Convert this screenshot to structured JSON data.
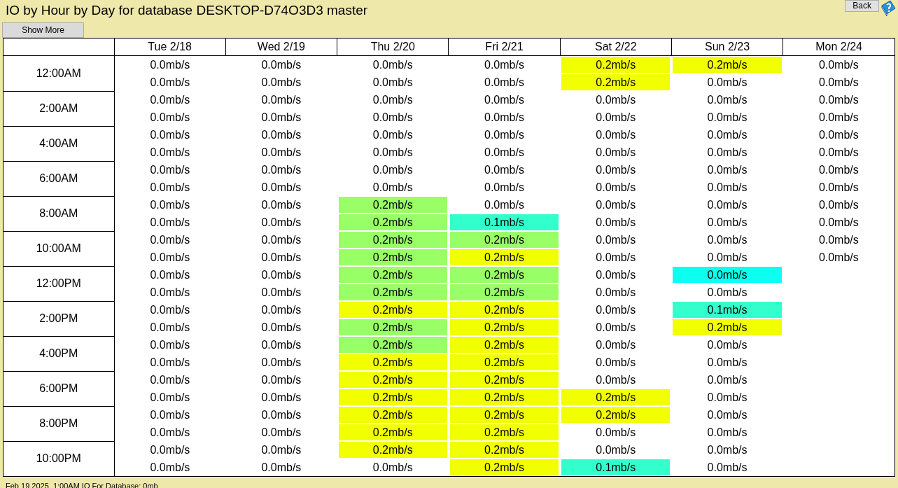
{
  "title": "IO by Hour by Day for database DESKTOP-D74O3D3 master",
  "buttons": {
    "show_more": "Show More",
    "back": "Back"
  },
  "columns": [
    "Tue 2/18",
    "Wed 2/19",
    "Thu 2/20",
    "Fri 2/21",
    "Sat 2/22",
    "Sun 2/23",
    "Mon 2/24"
  ],
  "time_labels": [
    "12:00AM",
    "2:00AM",
    "4:00AM",
    "6:00AM",
    "8:00AM",
    "10:00AM",
    "12:00PM",
    "2:00PM",
    "4:00PM",
    "6:00PM",
    "8:00PM",
    "10:00PM"
  ],
  "rows": [
    [
      {
        "text": "0.0mb/s"
      },
      {
        "text": "0.0mb/s"
      },
      {
        "text": "0.0mb/s"
      },
      {
        "text": "0.0mb/s"
      },
      {
        "text": "0.2mb/s",
        "color": "#f2ff00"
      },
      {
        "text": "0.2mb/s",
        "color": "#f2ff00"
      },
      {
        "text": "0.0mb/s"
      }
    ],
    [
      {
        "text": "0.0mb/s"
      },
      {
        "text": "0.0mb/s"
      },
      {
        "text": "0.0mb/s"
      },
      {
        "text": "0.0mb/s"
      },
      {
        "text": "0.2mb/s",
        "color": "#f2ff00"
      },
      {
        "text": "0.0mb/s"
      },
      {
        "text": "0.0mb/s"
      }
    ],
    [
      {
        "text": "0.0mb/s"
      },
      {
        "text": "0.0mb/s"
      },
      {
        "text": "0.0mb/s"
      },
      {
        "text": "0.0mb/s"
      },
      {
        "text": "0.0mb/s"
      },
      {
        "text": "0.0mb/s"
      },
      {
        "text": "0.0mb/s"
      }
    ],
    [
      {
        "text": "0.0mb/s"
      },
      {
        "text": "0.0mb/s"
      },
      {
        "text": "0.0mb/s"
      },
      {
        "text": "0.0mb/s"
      },
      {
        "text": "0.0mb/s"
      },
      {
        "text": "0.0mb/s"
      },
      {
        "text": "0.0mb/s"
      }
    ],
    [
      {
        "text": "0.0mb/s"
      },
      {
        "text": "0.0mb/s"
      },
      {
        "text": "0.0mb/s"
      },
      {
        "text": "0.0mb/s"
      },
      {
        "text": "0.0mb/s"
      },
      {
        "text": "0.0mb/s"
      },
      {
        "text": "0.0mb/s"
      }
    ],
    [
      {
        "text": "0.0mb/s"
      },
      {
        "text": "0.0mb/s"
      },
      {
        "text": "0.0mb/s"
      },
      {
        "text": "0.0mb/s"
      },
      {
        "text": "0.0mb/s"
      },
      {
        "text": "0.0mb/s"
      },
      {
        "text": "0.0mb/s"
      }
    ],
    [
      {
        "text": "0.0mb/s"
      },
      {
        "text": "0.0mb/s"
      },
      {
        "text": "0.0mb/s"
      },
      {
        "text": "0.0mb/s"
      },
      {
        "text": "0.0mb/s"
      },
      {
        "text": "0.0mb/s"
      },
      {
        "text": "0.0mb/s"
      }
    ],
    [
      {
        "text": "0.0mb/s"
      },
      {
        "text": "0.0mb/s"
      },
      {
        "text": "0.0mb/s"
      },
      {
        "text": "0.0mb/s"
      },
      {
        "text": "0.0mb/s"
      },
      {
        "text": "0.0mb/s"
      },
      {
        "text": "0.0mb/s"
      }
    ],
    [
      {
        "text": "0.0mb/s"
      },
      {
        "text": "0.0mb/s"
      },
      {
        "text": "0.2mb/s",
        "color": "#99ff66"
      },
      {
        "text": "0.0mb/s"
      },
      {
        "text": "0.0mb/s"
      },
      {
        "text": "0.0mb/s"
      },
      {
        "text": "0.0mb/s"
      }
    ],
    [
      {
        "text": "0.0mb/s"
      },
      {
        "text": "0.0mb/s"
      },
      {
        "text": "0.2mb/s",
        "color": "#99ff66"
      },
      {
        "text": "0.1mb/s",
        "color": "#33ffcc"
      },
      {
        "text": "0.0mb/s"
      },
      {
        "text": "0.0mb/s"
      },
      {
        "text": "0.0mb/s"
      }
    ],
    [
      {
        "text": "0.0mb/s"
      },
      {
        "text": "0.0mb/s"
      },
      {
        "text": "0.2mb/s",
        "color": "#99ff66"
      },
      {
        "text": "0.2mb/s",
        "color": "#99ff66"
      },
      {
        "text": "0.0mb/s"
      },
      {
        "text": "0.0mb/s"
      },
      {
        "text": "0.0mb/s"
      }
    ],
    [
      {
        "text": "0.0mb/s"
      },
      {
        "text": "0.0mb/s"
      },
      {
        "text": "0.2mb/s",
        "color": "#99ff66"
      },
      {
        "text": "0.2mb/s",
        "color": "#f2ff00"
      },
      {
        "text": "0.0mb/s"
      },
      {
        "text": "0.0mb/s"
      },
      {
        "text": "0.0mb/s"
      }
    ],
    [
      {
        "text": "0.0mb/s"
      },
      {
        "text": "0.0mb/s"
      },
      {
        "text": "0.2mb/s",
        "color": "#99ff66"
      },
      {
        "text": "0.2mb/s",
        "color": "#99ff66"
      },
      {
        "text": "0.0mb/s"
      },
      {
        "text": "0.0mb/s",
        "color": "#0cfff0"
      }
    ],
    [
      {
        "text": "0.0mb/s"
      },
      {
        "text": "0.0mb/s"
      },
      {
        "text": "0.2mb/s",
        "color": "#99ff66"
      },
      {
        "text": "0.2mb/s",
        "color": "#99ff66"
      },
      {
        "text": "0.0mb/s"
      },
      {
        "text": "0.0mb/s"
      }
    ],
    [
      {
        "text": "0.0mb/s"
      },
      {
        "text": "0.0mb/s"
      },
      {
        "text": "0.2mb/s",
        "color": "#f2ff00"
      },
      {
        "text": "0.2mb/s",
        "color": "#f2ff00"
      },
      {
        "text": "0.0mb/s"
      },
      {
        "text": "0.1mb/s",
        "color": "#33ffcc"
      }
    ],
    [
      {
        "text": "0.0mb/s"
      },
      {
        "text": "0.0mb/s"
      },
      {
        "text": "0.2mb/s",
        "color": "#99ff66"
      },
      {
        "text": "0.2mb/s",
        "color": "#f2ff00"
      },
      {
        "text": "0.0mb/s"
      },
      {
        "text": "0.2mb/s",
        "color": "#f2ff00"
      }
    ],
    [
      {
        "text": "0.0mb/s"
      },
      {
        "text": "0.0mb/s"
      },
      {
        "text": "0.2mb/s",
        "color": "#99ff66"
      },
      {
        "text": "0.2mb/s",
        "color": "#f2ff00"
      },
      {
        "text": "0.0mb/s"
      },
      {
        "text": "0.0mb/s"
      }
    ],
    [
      {
        "text": "0.0mb/s"
      },
      {
        "text": "0.0mb/s"
      },
      {
        "text": "0.2mb/s",
        "color": "#f2ff00"
      },
      {
        "text": "0.2mb/s",
        "color": "#f2ff00"
      },
      {
        "text": "0.0mb/s"
      },
      {
        "text": "0.0mb/s"
      }
    ],
    [
      {
        "text": "0.0mb/s"
      },
      {
        "text": "0.0mb/s"
      },
      {
        "text": "0.2mb/s",
        "color": "#f2ff00"
      },
      {
        "text": "0.2mb/s",
        "color": "#f2ff00"
      },
      {
        "text": "0.0mb/s"
      },
      {
        "text": "0.0mb/s"
      }
    ],
    [
      {
        "text": "0.0mb/s"
      },
      {
        "text": "0.0mb/s"
      },
      {
        "text": "0.2mb/s",
        "color": "#f2ff00"
      },
      {
        "text": "0.2mb/s",
        "color": "#f2ff00"
      },
      {
        "text": "0.2mb/s",
        "color": "#f2ff00"
      },
      {
        "text": "0.0mb/s"
      }
    ],
    [
      {
        "text": "0.0mb/s"
      },
      {
        "text": "0.0mb/s"
      },
      {
        "text": "0.2mb/s",
        "color": "#f2ff00"
      },
      {
        "text": "0.2mb/s",
        "color": "#f2ff00"
      },
      {
        "text": "0.2mb/s",
        "color": "#f2ff00"
      },
      {
        "text": "0.0mb/s"
      }
    ],
    [
      {
        "text": "0.0mb/s"
      },
      {
        "text": "0.0mb/s"
      },
      {
        "text": "0.2mb/s",
        "color": "#f2ff00"
      },
      {
        "text": "0.2mb/s",
        "color": "#f2ff00"
      },
      {
        "text": "0.0mb/s"
      },
      {
        "text": "0.0mb/s"
      }
    ],
    [
      {
        "text": "0.0mb/s"
      },
      {
        "text": "0.0mb/s"
      },
      {
        "text": "0.2mb/s",
        "color": "#f2ff00"
      },
      {
        "text": "0.2mb/s",
        "color": "#f2ff00"
      },
      {
        "text": "0.0mb/s"
      },
      {
        "text": "0.0mb/s"
      }
    ],
    [
      {
        "text": "0.0mb/s"
      },
      {
        "text": "0.0mb/s"
      },
      {
        "text": "0.0mb/s"
      },
      {
        "text": "0.2mb/s",
        "color": "#f2ff00"
      },
      {
        "text": "0.1mb/s",
        "color": "#33ffcc"
      },
      {
        "text": "0.0mb/s"
      }
    ]
  ],
  "status_bar": "Feb 19 2025  1:00AM IO For Database: 0mb"
}
